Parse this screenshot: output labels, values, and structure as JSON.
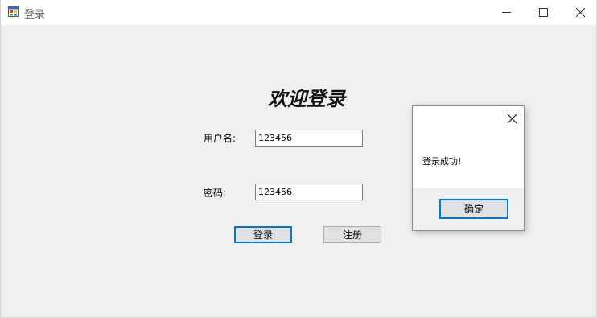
{
  "window": {
    "title": "登录",
    "icon": "app-window-icon",
    "controls": [
      "minimize-icon",
      "maximize-icon",
      "close-icon"
    ]
  },
  "form": {
    "heading": "欢迎登录",
    "username_label": "用户名:",
    "username_value": "123456",
    "password_label": "密码:",
    "password_value": "123456",
    "login_button": "登录",
    "register_button": "注册"
  },
  "dialog": {
    "message": "登录成功!",
    "ok_button": "确定",
    "close_icon": "close-icon"
  },
  "colors": {
    "accent": "#0078d7",
    "window_bg": "#f0f0f0"
  }
}
